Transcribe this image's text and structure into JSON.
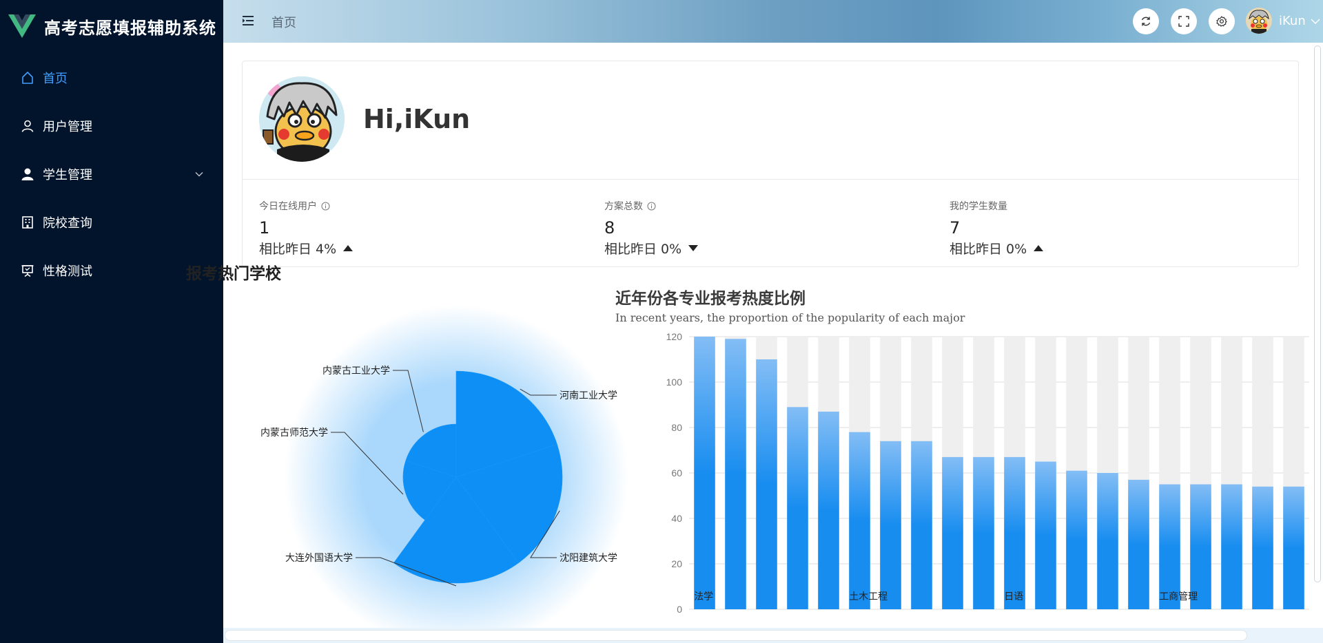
{
  "app": {
    "title": "高考志愿填报辅助系统",
    "brand_color": "#42b883"
  },
  "sidebar": {
    "items": [
      {
        "label": "首页",
        "icon": "home-icon",
        "active": true
      },
      {
        "label": "用户管理",
        "icon": "user-icon",
        "active": false
      },
      {
        "label": "学生管理",
        "icon": "user-solid-icon",
        "active": false,
        "has_submenu": true
      },
      {
        "label": "院校查询",
        "icon": "office-building-icon",
        "active": false
      },
      {
        "label": "性格测试",
        "icon": "presentation-icon",
        "active": false
      }
    ]
  },
  "header": {
    "breadcrumb": "首页",
    "icons": [
      "refresh-icon",
      "fullscreen-icon",
      "setting-icon"
    ],
    "user_name": "iKun"
  },
  "welcome": {
    "greeting": "Hi,iKun"
  },
  "stats": [
    {
      "label": "今日在线用户",
      "value": "1",
      "compare": "相比昨日 4%",
      "trend": "up",
      "has_info": true
    },
    {
      "label": "方案总数",
      "value": "8",
      "compare": "相比昨日 0%",
      "trend": "down",
      "has_info": true
    },
    {
      "label": "我的学生数量",
      "value": "7",
      "compare": "相比昨日 0%",
      "trend": "up",
      "has_info": false
    }
  ],
  "chart_data": [
    {
      "type": "pie",
      "title": "报考热门学校",
      "rose_type": "radius",
      "labels": [
        "河南工业大学",
        "沈阳建筑大学",
        "大连外国语大学",
        "内蒙古师范大学",
        "内蒙古工业大学"
      ],
      "values": [
        10,
        10,
        10,
        5,
        5
      ],
      "color": "#0d8ff5"
    },
    {
      "type": "bar",
      "title": "近年份各专业报考热度比例",
      "subtitle": "In recent years, the proportion of the popularity of each major",
      "ylim": [
        0,
        120
      ],
      "yticks": [
        0,
        20,
        40,
        60,
        80,
        100,
        120
      ],
      "category_labels": [
        {
          "index": 0,
          "label": "法学"
        },
        {
          "index": 5,
          "label": "土木工程"
        },
        {
          "index": 10,
          "label": "日语"
        },
        {
          "index": 15,
          "label": "工商管理"
        }
      ],
      "values": [
        120,
        119,
        110,
        89,
        87,
        78,
        74,
        74,
        67,
        67,
        67,
        65,
        61,
        60,
        57,
        55,
        55,
        55,
        54,
        54
      ],
      "background_max": 120,
      "bar_color_top": "#83bdf5",
      "bar_color_bottom": "#188df0",
      "background_color": "#efefef",
      "grid": true
    }
  ]
}
